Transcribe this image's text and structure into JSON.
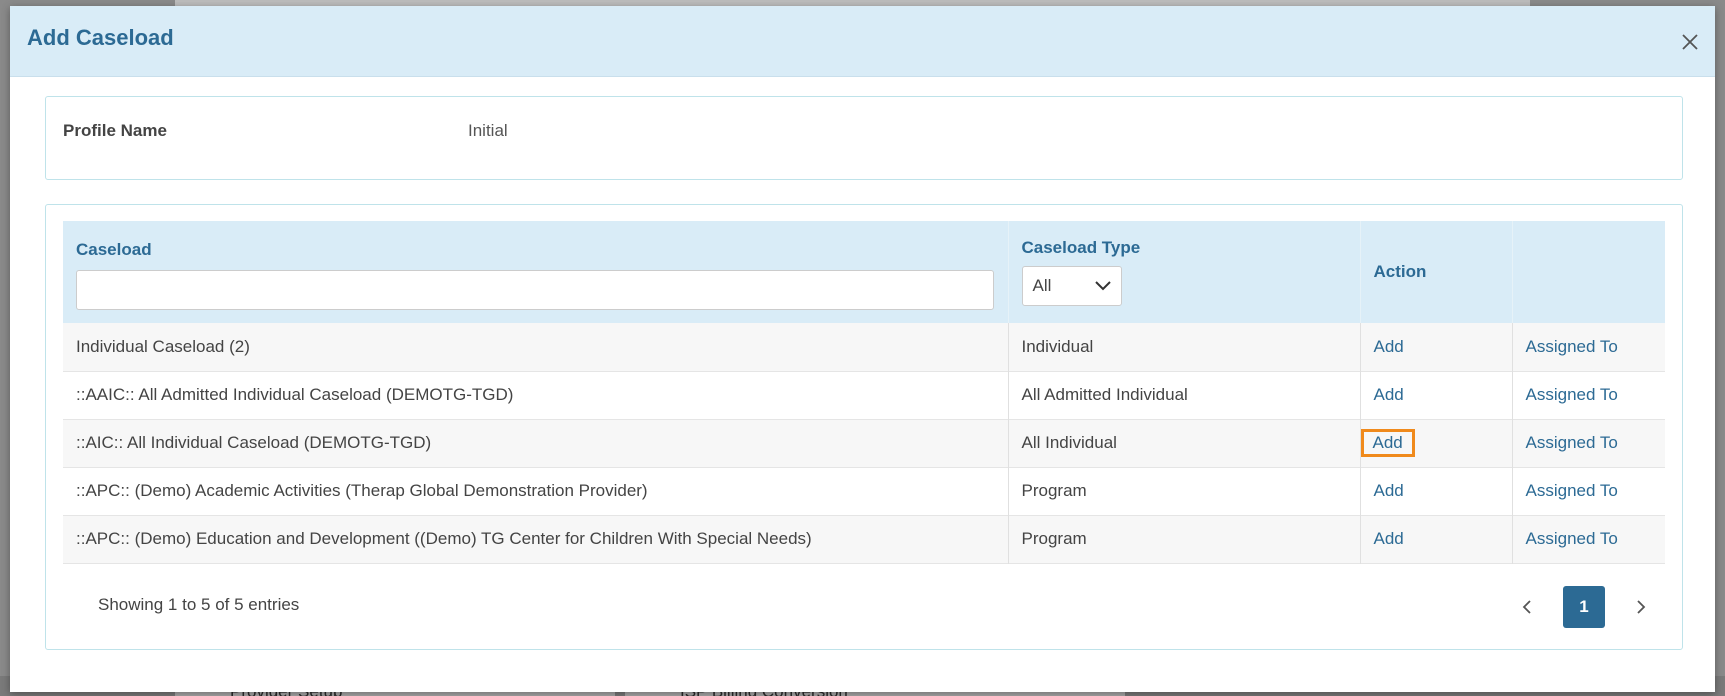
{
  "modal": {
    "title": "Add Caseload"
  },
  "profile": {
    "label": "Profile Name",
    "value": "Initial"
  },
  "table": {
    "headers": {
      "caseload": "Caseload",
      "caseload_type": "Caseload Type",
      "action": "Action"
    },
    "search": {
      "value": "",
      "placeholder": ""
    },
    "type_filter": {
      "selected": "All"
    },
    "rows": [
      {
        "caseload": "Individual Caseload (2)",
        "type": "Individual",
        "action": "Add",
        "assigned": "Assigned To"
      },
      {
        "caseload": "::AAIC:: All Admitted Individual Caseload (DEMOTG-TGD)",
        "type": "All Admitted Individual",
        "action": "Add",
        "assigned": "Assigned To"
      },
      {
        "caseload": "::AIC:: All Individual Caseload (DEMOTG-TGD)",
        "type": "All Individual",
        "action": "Add",
        "assigned": "Assigned To"
      },
      {
        "caseload": "::APC:: (Demo) Academic Activities (Therap Global Demonstration Provider)",
        "type": "Program",
        "action": "Add",
        "assigned": "Assigned To"
      },
      {
        "caseload": "::APC:: (Demo) Education and Development ((Demo) TG Center for Children With Special Needs)",
        "type": "Program",
        "action": "Add",
        "assigned": "Assigned To"
      }
    ]
  },
  "footer": {
    "info": "Showing 1 to 5 of 5 entries",
    "current_page": "1"
  },
  "backdrop": {
    "left_text": "Provider Setup",
    "right_text": "ISP Billing Conversion"
  },
  "colors": {
    "accent": "#2c6a94",
    "header_bg": "#d9ecf7",
    "highlight": "#f08a1c"
  }
}
